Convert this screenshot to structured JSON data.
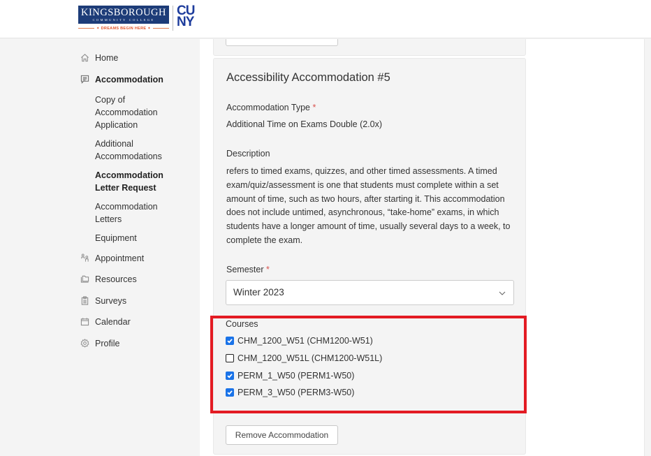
{
  "header": {
    "logo": {
      "college_name": "KINGSBOROUGH",
      "college_sub": "COMMUNITY COLLEGE",
      "tagline": "✦ DREAMS BEGIN HERE ✦",
      "cuny_line1": "CU",
      "cuny_line2": "NY"
    }
  },
  "sidebar": {
    "items": [
      {
        "label": "Home",
        "icon": "home-icon"
      },
      {
        "label": "Accommodation",
        "icon": "message-list-icon",
        "active": true
      },
      {
        "label": "Appointment",
        "icon": "people-icon"
      },
      {
        "label": "Resources",
        "icon": "folder-icon"
      },
      {
        "label": "Surveys",
        "icon": "clipboard-icon"
      },
      {
        "label": "Calendar",
        "icon": "calendar-icon"
      },
      {
        "label": "Profile",
        "icon": "gear-icon"
      }
    ],
    "sub_items": [
      {
        "label": "Copy of Accommodation Application"
      },
      {
        "label": "Additional Accommodations"
      },
      {
        "label": "Accommodation Letter Request",
        "active": true
      },
      {
        "label": "Accommodation Letters"
      },
      {
        "label": "Equipment"
      }
    ]
  },
  "card": {
    "title": "Accessibility Accommodation #5",
    "type_label": "Accommodation Type",
    "required_mark": "*",
    "type_value": "Additional Time on Exams Double (2.0x)",
    "description_label": "Description",
    "description_text": "refers to timed exams, quizzes, and other timed assessments. A timed exam/quiz/assessment is one that students must complete within a set amount of time, such as two hours, after starting it. This accommodation does not include untimed, asynchronous, “take-home” exams, in which students have a longer amount of time, usually several days to a week, to complete the exam.",
    "semester_label": "Semester",
    "semester_value": "Winter 2023",
    "courses_label": "Courses",
    "courses": [
      {
        "label": "CHM_1200_W51 (CHM1200-W51)",
        "checked": true
      },
      {
        "label": "CHM_1200_W51L (CHM1200-W51L)",
        "checked": false
      },
      {
        "label": "PERM_1_W50 (PERM1-W50)",
        "checked": true
      },
      {
        "label": "PERM_3_W50 (PERM3-W50)",
        "checked": true
      }
    ],
    "remove_button": "Remove Accommodation"
  },
  "colors": {
    "highlight_border": "#e31b23",
    "checkbox_checked": "#1a73e8",
    "brand_navy": "#1d3c78",
    "required": "#d9534f"
  }
}
